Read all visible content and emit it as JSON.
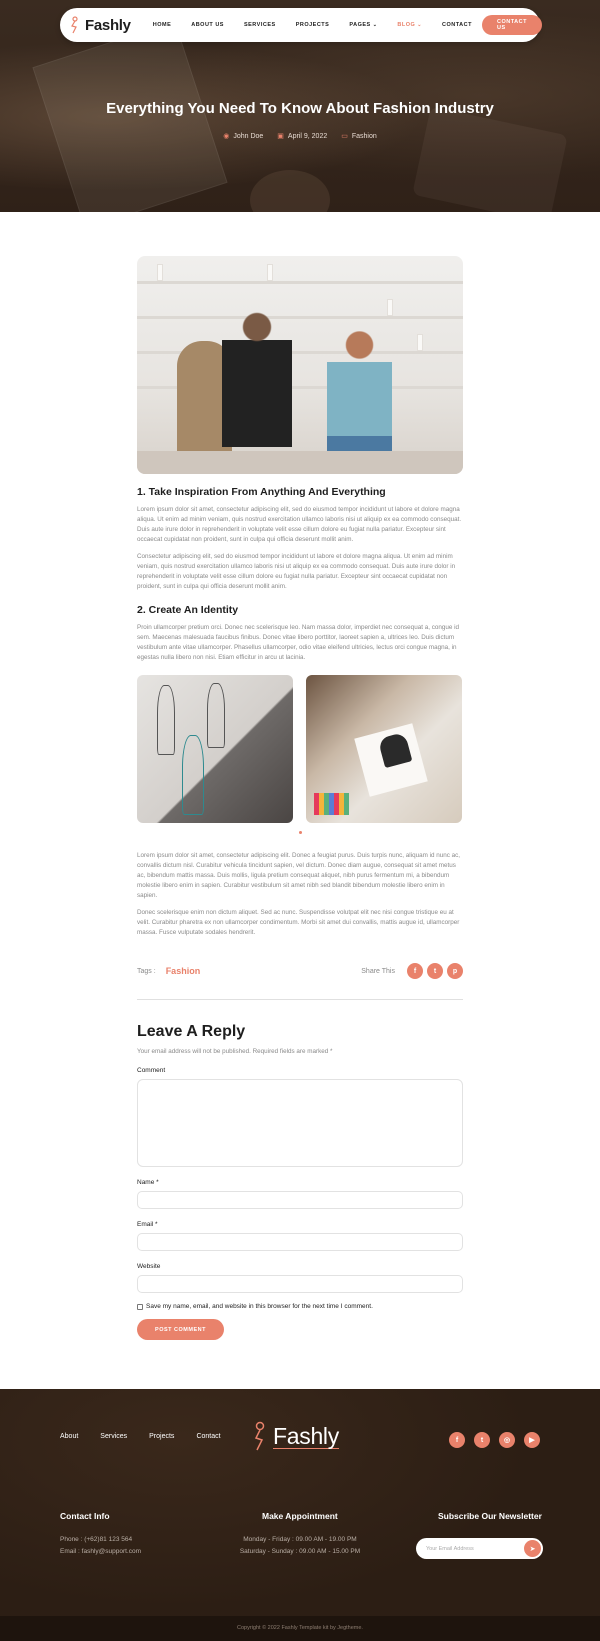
{
  "brand": {
    "name": "Fashly",
    "accent": "#e9826b",
    "dark_bg": "#2c1e14"
  },
  "nav": {
    "items": [
      {
        "label": "HOME"
      },
      {
        "label": "ABOUT US"
      },
      {
        "label": "SERVICES"
      },
      {
        "label": "PROJECTS"
      },
      {
        "label": "PAGES"
      },
      {
        "label": "BLOG"
      },
      {
        "label": "CONTACT"
      }
    ],
    "cta": "CONTACT US",
    "active": "BLOG"
  },
  "hero": {
    "title": "Everything You Need To Know About Fashion Industry",
    "author": "John Doe",
    "date": "April 9, 2022",
    "category": "Fashion"
  },
  "article": {
    "h1": "1. Take Inspiration From Anything And Everything",
    "p1": "Lorem ipsum dolor sit amet, consectetur adipiscing elit, sed do eiusmod tempor incididunt ut labore et dolore magna aliqua. Ut enim ad minim veniam, quis nostrud exercitation ullamco laboris nisi ut aliquip ex ea commodo consequat. Duis aute irure dolor in reprehenderit in voluptate velit esse cillum dolore eu fugiat nulla pariatur. Excepteur sint occaecat cupidatat non proident, sunt in culpa qui officia deserunt mollit anim.",
    "p2": "Consectetur adipiscing elit, sed do eiusmod tempor incididunt ut labore et dolore magna aliqua. Ut enim ad minim veniam, quis nostrud exercitation ullamco laboris nisi ut aliquip ex ea commodo consequat. Duis aute irure dolor in reprehenderit in voluptate velit esse cillum dolore eu fugiat nulla pariatur. Excepteur sint occaecat cupidatat non proident, sunt in culpa qui officia deserunt mollit anim.",
    "h2": "2. Create An Identity",
    "p3": "Proin ullamcorper pretium orci. Donec nec scelerisque leo. Nam massa dolor, imperdiet nec consequat a, congue id sem. Maecenas malesuada faucibus finibus. Donec vitae libero porttitor, laoreet sapien a, ultrices leo. Duis dictum vestibulum ante vitae ullamcorper. Phasellus ullamcorper, odio vitae eleifend ultricies, lectus orci congue magna, in egestas nulla libero non nisi. Etiam efficitur in arcu ut lacinia.",
    "p4": "Lorem ipsum dolor sit amet, consectetur adipiscing elit. Donec a feugiat purus. Duis turpis nunc, aliquam id nunc ac, convallis dictum nisl. Curabitur vehicula tincidunt sapien, vel dictum. Donec diam augue, consequat sit amet metus ac, bibendum mattis massa. Duis mollis, ligula pretium consequat aliquet, nibh purus fermentum mi, a bibendum molestie libero enim in sapien. Curabitur vestibulum sit amet nibh sed blandit bibendum molestie libero enim in sapien.",
    "p5": "Donec scelerisque enim non dictum aliquet. Sed ac nunc. Suspendisse volutpat elit nec nisi congue tristique eu at velit. Curabitur pharetra ex non ullamcorper condimentum. Morbi sit amet dui convallis, mattis augue id, ullamcorper massa. Fusce vulputate sodales hendrerit.",
    "tags_label": "Tags :",
    "tag": "Fashion",
    "share_label": "Share This"
  },
  "reply": {
    "title": "Leave A Reply",
    "note": "Your email address will not be published. Required fields are marked *",
    "comment_label": "Comment",
    "name_label": "Name *",
    "email_label": "Email *",
    "website_label": "Website",
    "save_label": "Save my name, email, and website in this browser for the next time I comment.",
    "submit": "POST COMMENT"
  },
  "footer": {
    "links": [
      {
        "label": "About"
      },
      {
        "label": "Services"
      },
      {
        "label": "Projects"
      },
      {
        "label": "Contact"
      }
    ],
    "contact_title": "Contact Info",
    "phone": "Phone : (+62)81 123 564",
    "email": "Email : fashly@support.com",
    "appointment_title": "Make Appointment",
    "hours1": "Monday - Friday : 09.00 AM - 19.00 PM",
    "hours2": "Saturday - Sunday : 09.00 AM - 15.00 PM",
    "newsletter_title": "Subscribe Our Newsletter",
    "newsletter_placeholder": "Your Email Address",
    "copyright": "Copyright © 2022 Fashly Template kit by Jegtheme."
  },
  "icons": {
    "author": "user-icon",
    "date": "calendar-icon",
    "category": "folder-icon",
    "share": [
      "facebook-icon",
      "twitter-icon",
      "pinterest-icon"
    ],
    "social": [
      "facebook-icon",
      "twitter-icon",
      "instagram-icon",
      "youtube-icon"
    ],
    "newsletter": "send-icon"
  }
}
